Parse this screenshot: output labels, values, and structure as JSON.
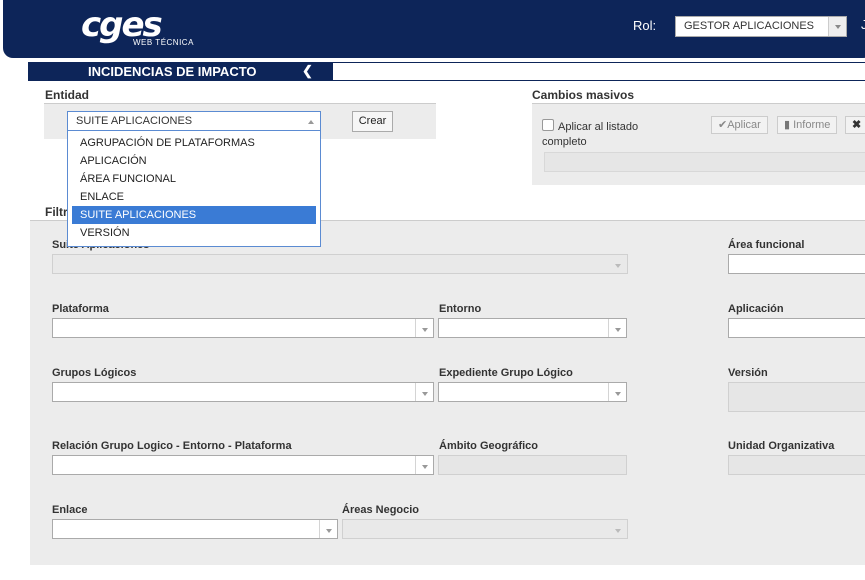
{
  "header": {
    "logo_main": "cges",
    "logo_sub": "WEB TÉCNICA",
    "rol_label": "Rol:",
    "rol_value": "GESTOR APLICACIONES",
    "user_initial": "J"
  },
  "title_bar": {
    "title": "INCIDENCIAS DE IMPACTO",
    "collapse_icon": "chevron-left-icon"
  },
  "entidad": {
    "label": "Entidad",
    "selected": "SUITE APLICACIONES",
    "options": [
      "AGRUPACIÓN DE PLATAFORMAS",
      "APLICACIÓN",
      "ÁREA FUNCIONAL",
      "ENLACE",
      "SUITE APLICACIONES",
      "VERSIÓN"
    ],
    "highlighted_index": 4,
    "crear_label": "Crear"
  },
  "cambios_masivos": {
    "label": "Cambios masivos",
    "checkbox_label_1": "Aplicar al listado",
    "checkbox_label_2": "completo",
    "aplicar_label": "Aplicar",
    "informe_label": "Informe",
    "close_symbol": "✖"
  },
  "filtros": {
    "label": "Filtr",
    "suite_label": "Suite Aplicaciones",
    "area_funcional_label": "Área funcional",
    "plataforma_label": "Plataforma",
    "entorno_label": "Entorno",
    "aplicacion_label": "Aplicación",
    "grupos_logicos_label": "Grupos Lógicos",
    "expediente_label": "Expediente Grupo Lógico",
    "version_label": "Versión",
    "relacion_label": "Relación Grupo Logico - Entorno - Plataforma",
    "ambito_label": "Ámbito Geográfico",
    "unidad_label": "Unidad Organizativa",
    "enlace_label": "Enlace",
    "areas_negocio_label": "Áreas Negocio"
  },
  "colors": {
    "brand_navy": "#0d2559",
    "highlight_blue": "#3a7bd5",
    "panel_gray": "#ececec"
  }
}
